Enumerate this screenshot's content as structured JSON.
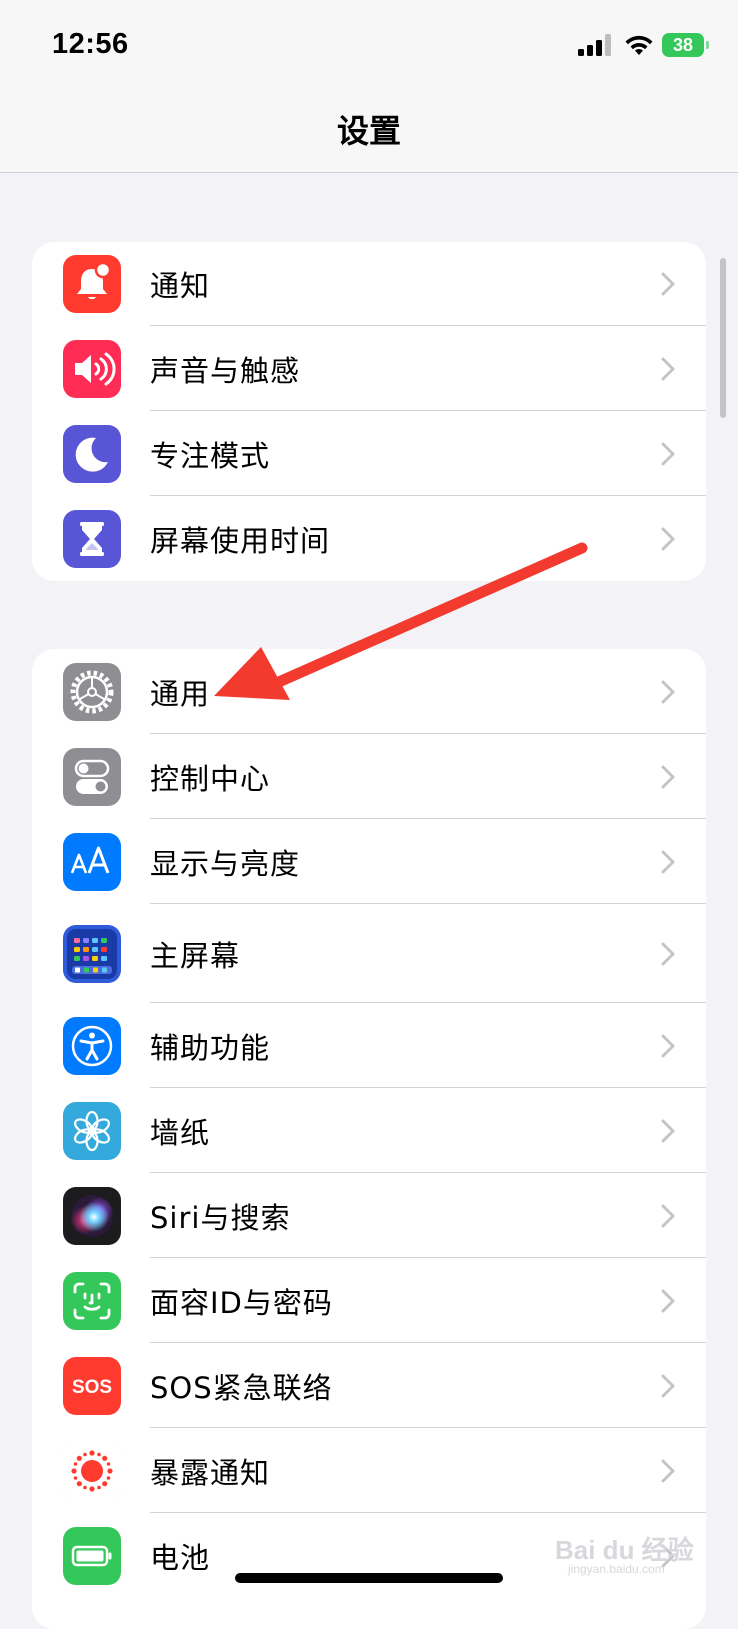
{
  "status_bar": {
    "time": "12:56",
    "battery": "38"
  },
  "header": {
    "title": "设置"
  },
  "groups": [
    {
      "items": [
        {
          "label": "通知",
          "icon": "bell-icon",
          "color": "#ff3b30"
        },
        {
          "label": "声音与触感",
          "icon": "speaker-icon",
          "color": "#ff2d55"
        },
        {
          "label": "专注模式",
          "icon": "moon-icon",
          "color": "#5856d6"
        },
        {
          "label": "屏幕使用时间",
          "icon": "hourglass-icon",
          "color": "#5856d6"
        }
      ]
    },
    {
      "items": [
        {
          "label": "通用",
          "icon": "gear-icon",
          "color": "#8e8e93"
        },
        {
          "label": "控制中心",
          "icon": "toggles-icon",
          "color": "#8e8e93"
        },
        {
          "label": "显示与亮度",
          "icon": "text-size-icon",
          "color": "#007aff"
        },
        {
          "label": "主屏幕",
          "icon": "home-grid-icon",
          "color": "#2f5bd8"
        },
        {
          "label": "辅助功能",
          "icon": "accessibility-icon",
          "color": "#007aff"
        },
        {
          "label": "墙纸",
          "icon": "flower-icon",
          "color": "#34aadc"
        },
        {
          "label": "Siri与搜索",
          "icon": "siri-icon",
          "color": "#1c1c1e"
        },
        {
          "label": "面容ID与密码",
          "icon": "face-id-icon",
          "color": "#34c759"
        },
        {
          "label": "SOS紧急联络",
          "icon": "sos-icon",
          "color": "#ff3b30",
          "icon_text": "SOS"
        },
        {
          "label": "暴露通知",
          "icon": "exposure-icon",
          "color": "#ffffff"
        },
        {
          "label": "电池",
          "icon": "battery-icon",
          "color": "#34c759"
        }
      ]
    }
  ],
  "watermark": {
    "text": "Bai du 经验",
    "sub": "jingyan.baidu.com"
  },
  "annotation": {
    "color": "#f23a2e"
  }
}
